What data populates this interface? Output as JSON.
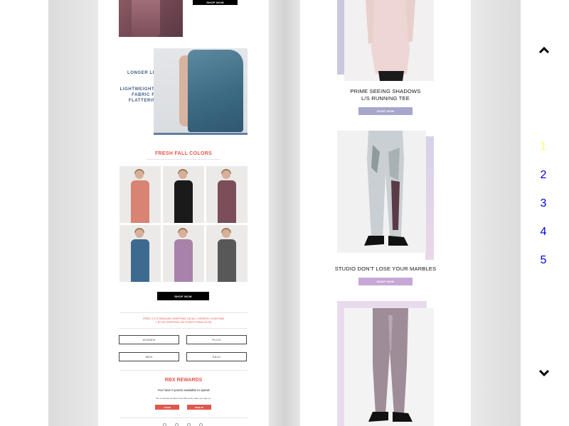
{
  "left_page": {
    "top_shop_button": "SHOP NOW",
    "promo_line1": "LONGER LENGTH.",
    "promo_line2": "LIGHTWEIGHT DRAPING FABRIC FOR A FLATTERING FIT.",
    "colors_title": "FRESH FALL COLORS",
    "tiles": [
      "#d98372",
      "#1a1a1a",
      "#7b4e5a",
      "#3e6a90",
      "#a882a8",
      "#585858"
    ],
    "grid_shop_button": "SHOP NOW",
    "shipping_line1": "FREE 2-5 STANDARD SHIPPING ON ALL ORDERS OVER $50",
    "shipping_line2": "+ $7.95 SHIPPING ON EVERYTHING ELSE",
    "category_buttons": [
      "WOMEN",
      "PLUS",
      "MEN",
      "SALE"
    ],
    "rewards_title": "RBX REWARDS",
    "rewards_points": "You have 0 points available to spend",
    "rewards_note": "Not a rewards member? Get 200 points when you sign up.",
    "login_button": "LOGIN",
    "signup_button": "SIGN UP"
  },
  "right_page": {
    "products": [
      {
        "name_line1": "PRIME SEEING SHADOWS",
        "name_line2": "L/S RUNNING TEE",
        "button": "SHOP NOW",
        "button_color": "#a7a6cc"
      },
      {
        "name_line1": "STUDIO DON'T LOSE YOUR MARBLES",
        "name_line2": "",
        "button": "SHOP NOW",
        "button_color": "#c7a7d6"
      },
      {
        "name_line1": "",
        "name_line2": "",
        "button": "",
        "button_color": "#c7a7d6"
      }
    ]
  },
  "scroll_controls": {
    "up_icon": "chevron-up-icon",
    "down_icon": "chevron-down-icon",
    "pages": [
      "1",
      "2",
      "3",
      "4",
      "5"
    ],
    "current_page": "1",
    "current_color": "#ffff66",
    "link_color": "#0000dd"
  }
}
